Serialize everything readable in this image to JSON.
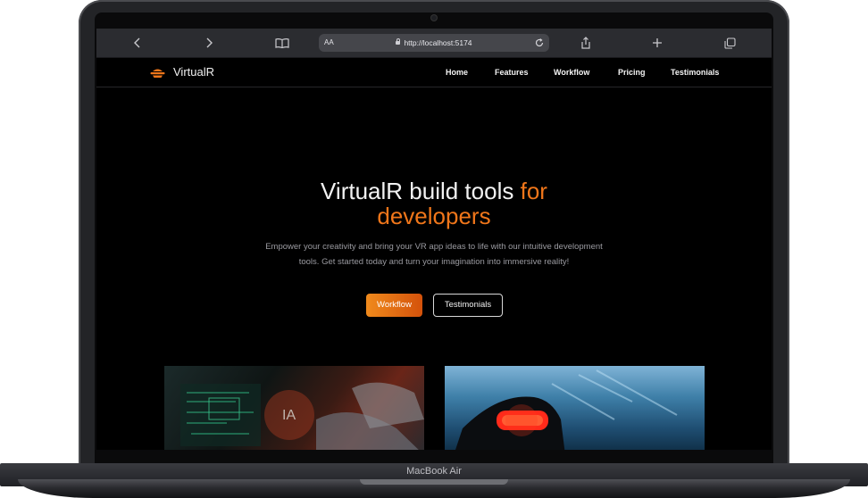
{
  "browser": {
    "back_icon": "chevron-left-icon",
    "forward_icon": "chevron-right-icon",
    "reader_icon": "book-icon",
    "text_size": "AA",
    "url": "http://localhost:5174",
    "reload_icon": "reload-icon",
    "share_icon": "share-icon",
    "new_tab_icon": "plus-icon",
    "tabs_icon": "tabs-icon"
  },
  "nav": {
    "brand": "VirtualR",
    "links": [
      "Home",
      "Features",
      "Workflow",
      "Pricing",
      "Testimonials"
    ]
  },
  "hero": {
    "title_main": "VirtualR build tools",
    "title_accent_1": "for",
    "title_accent_2": "developers",
    "subtitle": "Empower your creativity and bring your VR app ideas to life with our intuitive development tools. Get started today and turn your imagination into immersive reality!",
    "primary_button": "Workflow",
    "secondary_button": "Testimonials"
  },
  "device": {
    "label": "MacBook Air"
  },
  "colors": {
    "accent": "#f0761a",
    "background": "#000000"
  }
}
